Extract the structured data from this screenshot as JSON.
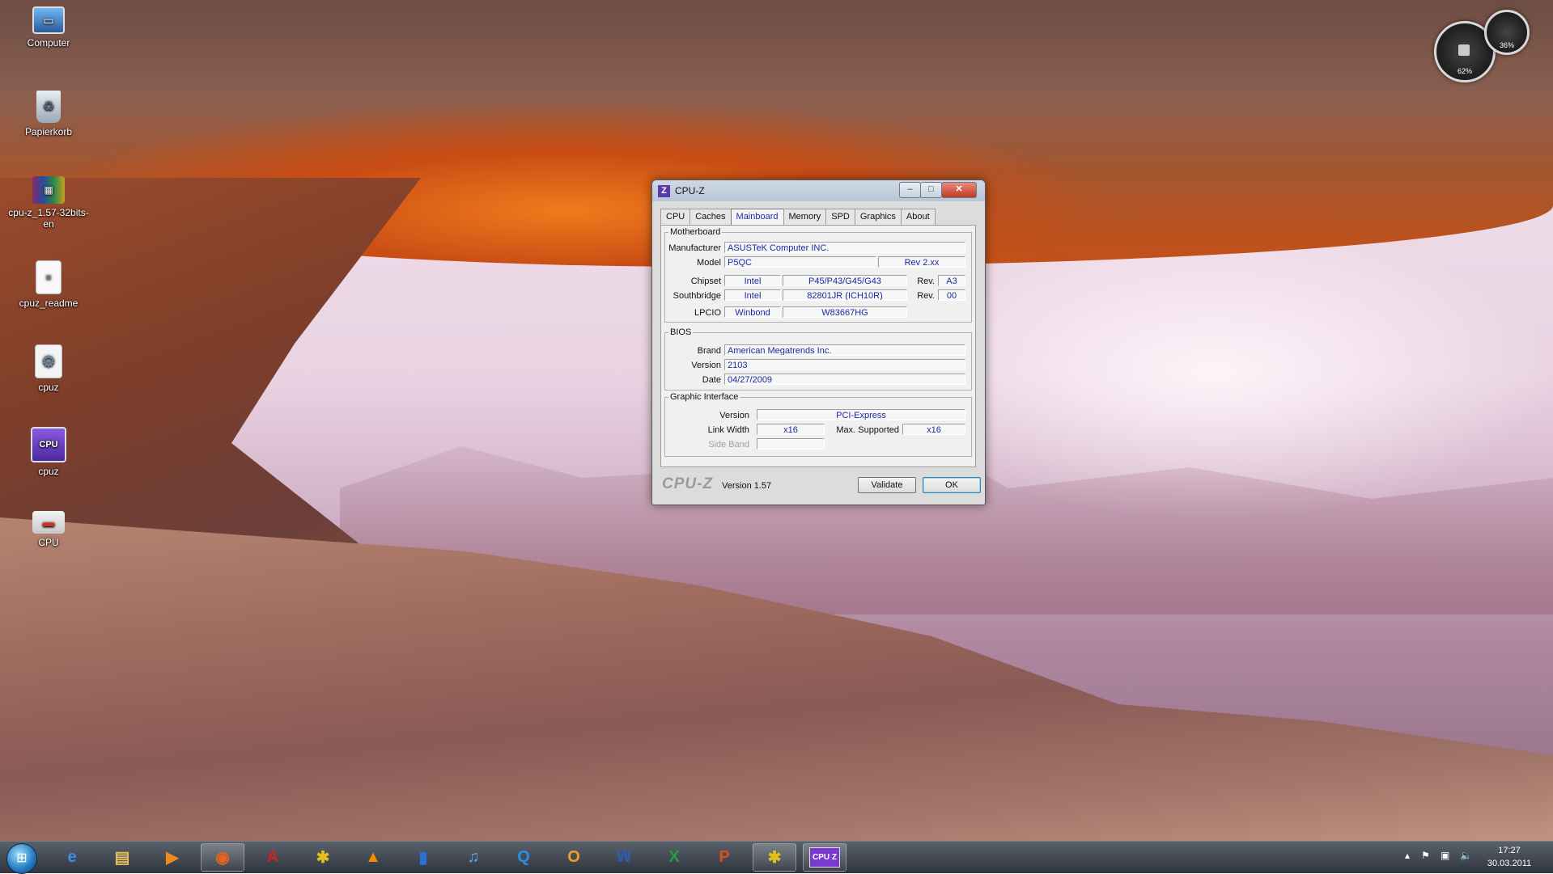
{
  "desktop": {
    "icons": [
      {
        "label": "Computer"
      },
      {
        "label": "Papierkorb"
      },
      {
        "label": "cpu-z_1.57-32bits-en"
      },
      {
        "label": "cpuz_readme"
      },
      {
        "label": "cpuz"
      },
      {
        "label": "cpuz"
      },
      {
        "label": "CPU"
      }
    ],
    "gadget": {
      "cpu_percent": "62%",
      "memory_percent": "36%"
    }
  },
  "window": {
    "title": "CPU-Z",
    "app_icon": "Z",
    "tabs": [
      "CPU",
      "Caches",
      "Mainboard",
      "Memory",
      "SPD",
      "Graphics",
      "About"
    ],
    "active_tab": "Mainboard",
    "motherboard": {
      "legend": "Motherboard",
      "manufacturer_label": "Manufacturer",
      "manufacturer": "ASUSTeK Computer INC.",
      "model_label": "Model",
      "model": "P5QC",
      "model_rev": "Rev 2.xx",
      "chipset_label": "Chipset",
      "chipset_vendor": "Intel",
      "chipset_model": "P45/P43/G45/G43",
      "chipset_rev_label": "Rev.",
      "chipset_rev": "A3",
      "southbridge_label": "Southbridge",
      "southbridge_vendor": "Intel",
      "southbridge_model": "82801JR (ICH10R)",
      "southbridge_rev_label": "Rev.",
      "southbridge_rev": "00",
      "lpcio_label": "LPCIO",
      "lpcio_vendor": "Winbond",
      "lpcio_model": "W83667HG"
    },
    "bios": {
      "legend": "BIOS",
      "brand_label": "Brand",
      "brand": "American Megatrends Inc.",
      "version_label": "Version",
      "version": "2103",
      "date_label": "Date",
      "date": "04/27/2009"
    },
    "graphic_interface": {
      "legend": "Graphic Interface",
      "version_label": "Version",
      "version": "PCI-Express",
      "link_width_label": "Link Width",
      "link_width": "x16",
      "max_supported_label": "Max. Supported",
      "max_supported": "x16",
      "side_band_label": "Side Band",
      "side_band": ""
    },
    "footer": {
      "logo": "CPU-Z",
      "version": "Version 1.57",
      "validate_label": "Validate",
      "ok_label": "OK"
    }
  },
  "taskbar": {
    "items": [
      {
        "icon": "internet-explorer-icon",
        "glyph": "e",
        "color": "#3a8ee6"
      },
      {
        "icon": "explorer-folder-icon",
        "glyph": "▤",
        "color": "#e8c25a"
      },
      {
        "icon": "media-player-icon",
        "glyph": "▶",
        "color": "#f08a1c"
      },
      {
        "icon": "firefox-icon",
        "glyph": "◉",
        "color": "#e8641c"
      },
      {
        "icon": "acrobat-reader-icon",
        "glyph": "A",
        "color": "#d42020"
      },
      {
        "icon": "app-yellow-icon",
        "glyph": "✱",
        "color": "#e0c020"
      },
      {
        "icon": "vlc-icon",
        "glyph": "▲",
        "color": "#f28a00"
      },
      {
        "icon": "app-blue-icon",
        "glyph": "▮",
        "color": "#2a6ed8"
      },
      {
        "icon": "itunes-icon",
        "glyph": "♫",
        "color": "#5aa8f0"
      },
      {
        "icon": "app-search-icon",
        "glyph": "Q",
        "color": "#2a90e0"
      },
      {
        "icon": "outlook-icon",
        "glyph": "O",
        "color": "#f0a020"
      },
      {
        "icon": "word-icon",
        "glyph": "W",
        "color": "#2a5db8"
      },
      {
        "icon": "excel-icon",
        "glyph": "X",
        "color": "#2a9a40"
      },
      {
        "icon": "powerpoint-icon",
        "glyph": "P",
        "color": "#d85020"
      },
      {
        "icon": "app-yellow2-icon",
        "glyph": "✱",
        "color": "#e0c020"
      },
      {
        "icon": "cpuz-icon",
        "glyph": "CPU Z",
        "color": "#7a3ad0"
      }
    ],
    "clock_time": "17:27",
    "clock_date": "30.03.2011"
  }
}
